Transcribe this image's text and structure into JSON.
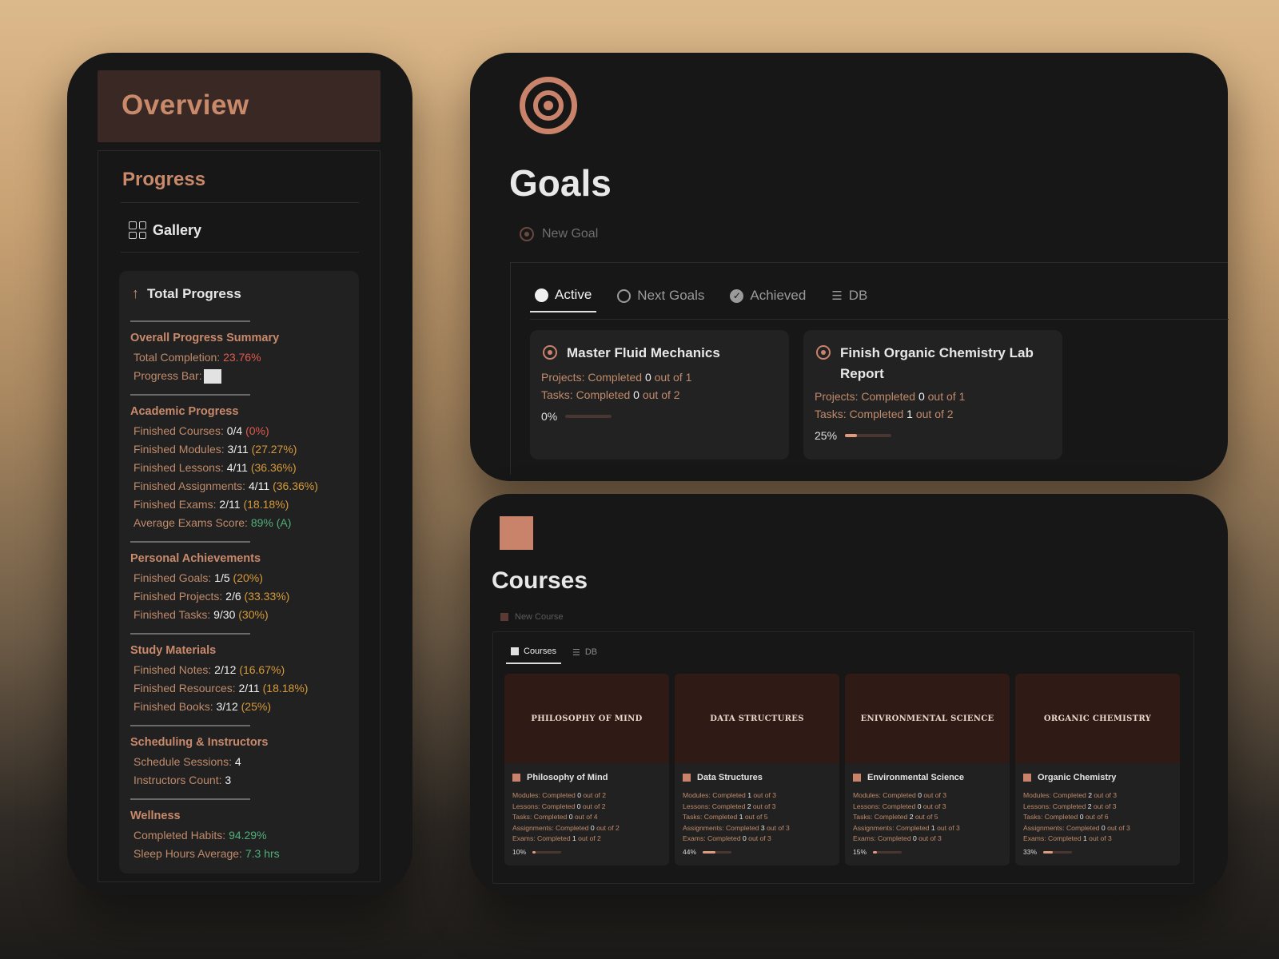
{
  "overview": {
    "title": "Overview",
    "progress_title": "Progress",
    "gallery_label": "Gallery",
    "total_progress_label": "Total Progress",
    "sections": [
      {
        "title": "Overall Progress Summary",
        "lines": [
          {
            "label": "Total Completion:",
            "value": "",
            "pct": "23.76%",
            "pct_color": "red"
          },
          {
            "label": "Progress Bar:",
            "value": "",
            "pct": "",
            "pct_color": "",
            "bar": true
          }
        ]
      },
      {
        "title": "Academic Progress",
        "lines": [
          {
            "label": "Finished Courses:",
            "value": "0/4",
            "pct": "(0%)",
            "pct_color": "red"
          },
          {
            "label": "Finished Modules:",
            "value": "3/11",
            "pct": "(27.27%)",
            "pct_color": "amb"
          },
          {
            "label": "Finished Lessons:",
            "value": "4/11",
            "pct": "(36.36%)",
            "pct_color": "amb"
          },
          {
            "label": "Finished Assignments:",
            "value": "4/11",
            "pct": "(36.36%)",
            "pct_color": "amb"
          },
          {
            "label": "Finished Exams:",
            "value": "2/11",
            "pct": "(18.18%)",
            "pct_color": "amb"
          },
          {
            "label": "Average Exams Score:",
            "value": "",
            "pct": "89% (A)",
            "pct_color": "grn"
          }
        ]
      },
      {
        "title": "Personal Achievements",
        "lines": [
          {
            "label": "Finished Goals:",
            "value": "1/5",
            "pct": "(20%)",
            "pct_color": "amb"
          },
          {
            "label": "Finished Projects:",
            "value": "2/6",
            "pct": "(33.33%)",
            "pct_color": "amb"
          },
          {
            "label": "Finished Tasks:",
            "value": "9/30",
            "pct": "(30%)",
            "pct_color": "amb"
          }
        ]
      },
      {
        "title": "Study Materials",
        "lines": [
          {
            "label": "Finished Notes:",
            "value": "2/12",
            "pct": "(16.67%)",
            "pct_color": "amb"
          },
          {
            "label": "Finished Resources:",
            "value": "2/11",
            "pct": "(18.18%)",
            "pct_color": "amb"
          },
          {
            "label": "Finished Books:",
            "value": "3/12",
            "pct": "(25%)",
            "pct_color": "amb"
          }
        ]
      },
      {
        "title": "Scheduling & Instructors",
        "lines": [
          {
            "label": "Schedule Sessions:",
            "value": "4",
            "pct": "",
            "pct_color": ""
          },
          {
            "label": "Instructors Count:",
            "value": "3",
            "pct": "",
            "pct_color": ""
          }
        ]
      },
      {
        "title": "Wellness",
        "lines": [
          {
            "label": "Completed Habits:",
            "value": "",
            "pct": "94.29%",
            "pct_color": "grn"
          },
          {
            "label": "Sleep Hours Average:",
            "value": "",
            "pct": "7.3 hrs",
            "pct_color": "grn"
          }
        ]
      }
    ]
  },
  "goals": {
    "icon": "target-icon",
    "title": "Goals",
    "new_goal_label": "New Goal",
    "tabs": [
      {
        "label": "Active",
        "icon": "filled-circle-icon",
        "active": true
      },
      {
        "label": "Next Goals",
        "icon": "empty-circle-icon",
        "active": false
      },
      {
        "label": "Achieved",
        "icon": "check-circle-icon",
        "active": false
      },
      {
        "label": "DB",
        "icon": "database-icon",
        "active": false
      }
    ],
    "cards": [
      {
        "name": "Master Fluid Mechanics",
        "projects_label": "Projects: Completed",
        "projects_done": "0",
        "projects_of": "out of",
        "projects_total": "1",
        "tasks_label": "Tasks: Completed",
        "tasks_done": "0",
        "tasks_of": "out of",
        "tasks_total": "2",
        "progress_label": "0%",
        "progress": 0
      },
      {
        "name": "Finish Organic Chemistry Lab Report",
        "projects_label": "Projects: Completed",
        "projects_done": "0",
        "projects_of": "out of",
        "projects_total": "1",
        "tasks_label": "Tasks: Completed",
        "tasks_done": "1",
        "tasks_of": "out of",
        "tasks_total": "2",
        "progress_label": "25%",
        "progress": 0.25
      }
    ]
  },
  "courses": {
    "title": "Courses",
    "new_course_label": "New Course",
    "tabs": [
      {
        "label": "Courses",
        "active": true
      },
      {
        "label": "DB",
        "active": false
      }
    ],
    "cards": [
      {
        "cover": "PHILOSOPHY OF MIND",
        "name": "Philosophy of Mind",
        "lines": [
          [
            "Modules: Completed",
            "0",
            "out of 2"
          ],
          [
            "Lessons: Completed",
            "0",
            "out of 2"
          ],
          [
            "Tasks: Completed",
            "0",
            "out of 4"
          ],
          [
            "Assignments: Completed",
            "0",
            "out of 2"
          ],
          [
            "Exams: Completed",
            "1",
            "out of 2"
          ]
        ],
        "progress_label": "10%",
        "progress": 0.1
      },
      {
        "cover": "DATA STRUCTURES",
        "name": "Data Structures",
        "lines": [
          [
            "Modules: Completed",
            "1",
            "out of 3"
          ],
          [
            "Lessons: Completed",
            "2",
            "out of 3"
          ],
          [
            "Tasks: Completed",
            "1",
            "out of 5"
          ],
          [
            "Assignments: Completed",
            "3",
            "out of 3"
          ],
          [
            "Exams: Completed",
            "0",
            "out of 3"
          ]
        ],
        "progress_label": "44%",
        "progress": 0.44
      },
      {
        "cover": "ENIVRONMENTAL SCIENCE",
        "name": "Environmental Science",
        "lines": [
          [
            "Modules: Completed",
            "0",
            "out of 3"
          ],
          [
            "Lessons: Completed",
            "0",
            "out of 3"
          ],
          [
            "Tasks: Completed",
            "2",
            "out of 5"
          ],
          [
            "Assignments: Completed",
            "1",
            "out of 3"
          ],
          [
            "Exams: Completed",
            "0",
            "out of 3"
          ]
        ],
        "progress_label": "15%",
        "progress": 0.15
      },
      {
        "cover": "ORGANIC CHEMISTRY",
        "name": "Organic Chemistry",
        "lines": [
          [
            "Modules: Completed",
            "2",
            "out of 3"
          ],
          [
            "Lessons: Completed",
            "2",
            "out of 3"
          ],
          [
            "Tasks: Completed",
            "0",
            "out of 6"
          ],
          [
            "Assignments: Completed",
            "0",
            "out of 3"
          ],
          [
            "Exams: Completed",
            "1",
            "out of 3"
          ]
        ],
        "progress_label": "33%",
        "progress": 0.33
      }
    ]
  },
  "colors": {
    "accent": "#c9836b",
    "panel": "#171717",
    "card": "#212121"
  }
}
